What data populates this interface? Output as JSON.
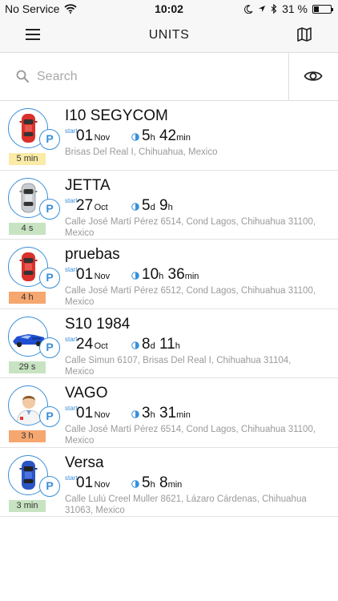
{
  "status_bar": {
    "carrier": "No Service",
    "time": "10:02",
    "battery_text": "31 %",
    "battery_level": 0.31,
    "icons": [
      "wifi-icon",
      "moon-icon",
      "location-arrow-icon",
      "bluetooth-icon",
      "battery-icon"
    ]
  },
  "header": {
    "title": "UNITS",
    "menu_icon": "hamburger-menu-icon",
    "map_icon": "map-icon"
  },
  "search": {
    "placeholder": "Search",
    "value": "",
    "visibility_icon": "eye-icon"
  },
  "colors": {
    "accent": "#3a8fd9",
    "badge_yellow": "#fbeba6",
    "badge_green": "#c7e3c2",
    "badge_orange": "#f6a66f"
  },
  "units": [
    {
      "name": "I10 SEGYCOM",
      "avatar": "red-car-icon",
      "status_icon": "parking-icon",
      "parking_letter": "P",
      "time_ago": "5 min",
      "badge_color": "#fbeba6",
      "start_label": "start",
      "start_day": "01",
      "start_month": "Nov",
      "duration_big_1": "5",
      "duration_unit_1": "h",
      "duration_big_2": "42",
      "duration_unit_2": "min",
      "address": "Brisas Del Real I, Chihuahua, Mexico"
    },
    {
      "name": "JETTA",
      "avatar": "silver-car-icon",
      "status_icon": "parking-icon",
      "parking_letter": "P",
      "time_ago": "4 s",
      "badge_color": "#c7e3c2",
      "start_label": "start",
      "start_day": "27",
      "start_month": "Oct",
      "duration_big_1": "5",
      "duration_unit_1": "d",
      "duration_big_2": "9",
      "duration_unit_2": "h",
      "address": "Calle José Martí Pérez 6514, Cond Lagos, Chihuahua 31100, Mexico"
    },
    {
      "name": "pruebas",
      "avatar": "red-car-icon",
      "status_icon": "parking-icon",
      "parking_letter": "P",
      "time_ago": "4 h",
      "badge_color": "#f6a66f",
      "start_label": "start",
      "start_day": "01",
      "start_month": "Nov",
      "duration_big_1": "10",
      "duration_unit_1": "h",
      "duration_big_2": "36",
      "duration_unit_2": "min",
      "address": "Calle José Martí Pérez 6512, Cond Lagos, Chihuahua 31100, Mexico"
    },
    {
      "name": "S10 1984",
      "avatar": "blue-pickup-truck-icon",
      "status_icon": "parking-icon",
      "parking_letter": "P",
      "time_ago": "29 s",
      "badge_color": "#c7e3c2",
      "start_label": "start",
      "start_day": "24",
      "start_month": "Oct",
      "duration_big_1": "8",
      "duration_unit_1": "d",
      "duration_big_2": "11",
      "duration_unit_2": "h",
      "address": "Calle Simun 6107, Brisas Del Real I, Chihuahua 31104, Mexico"
    },
    {
      "name": "VAGO",
      "avatar": "doctor-person-icon",
      "status_icon": "parking-icon",
      "parking_letter": "P",
      "time_ago": "3 h",
      "badge_color": "#f6a66f",
      "start_label": "start",
      "start_day": "01",
      "start_month": "Nov",
      "duration_big_1": "3",
      "duration_unit_1": "h",
      "duration_big_2": "31",
      "duration_unit_2": "min",
      "address": "Calle José Martí Pérez 6514, Cond Lagos, Chihuahua 31100, Mexico"
    },
    {
      "name": "Versa",
      "avatar": "blue-car-icon",
      "status_icon": "parking-icon",
      "parking_letter": "P",
      "time_ago": "3 min",
      "badge_color": "#c7e3c2",
      "start_label": "start",
      "start_day": "01",
      "start_month": "Nov",
      "duration_big_1": "5",
      "duration_unit_1": "h",
      "duration_big_2": "8",
      "duration_unit_2": "min",
      "address": "Calle Lulú Creel Muller 8621, Lázaro Cárdenas, Chihuahua 31063, Mexico"
    }
  ]
}
